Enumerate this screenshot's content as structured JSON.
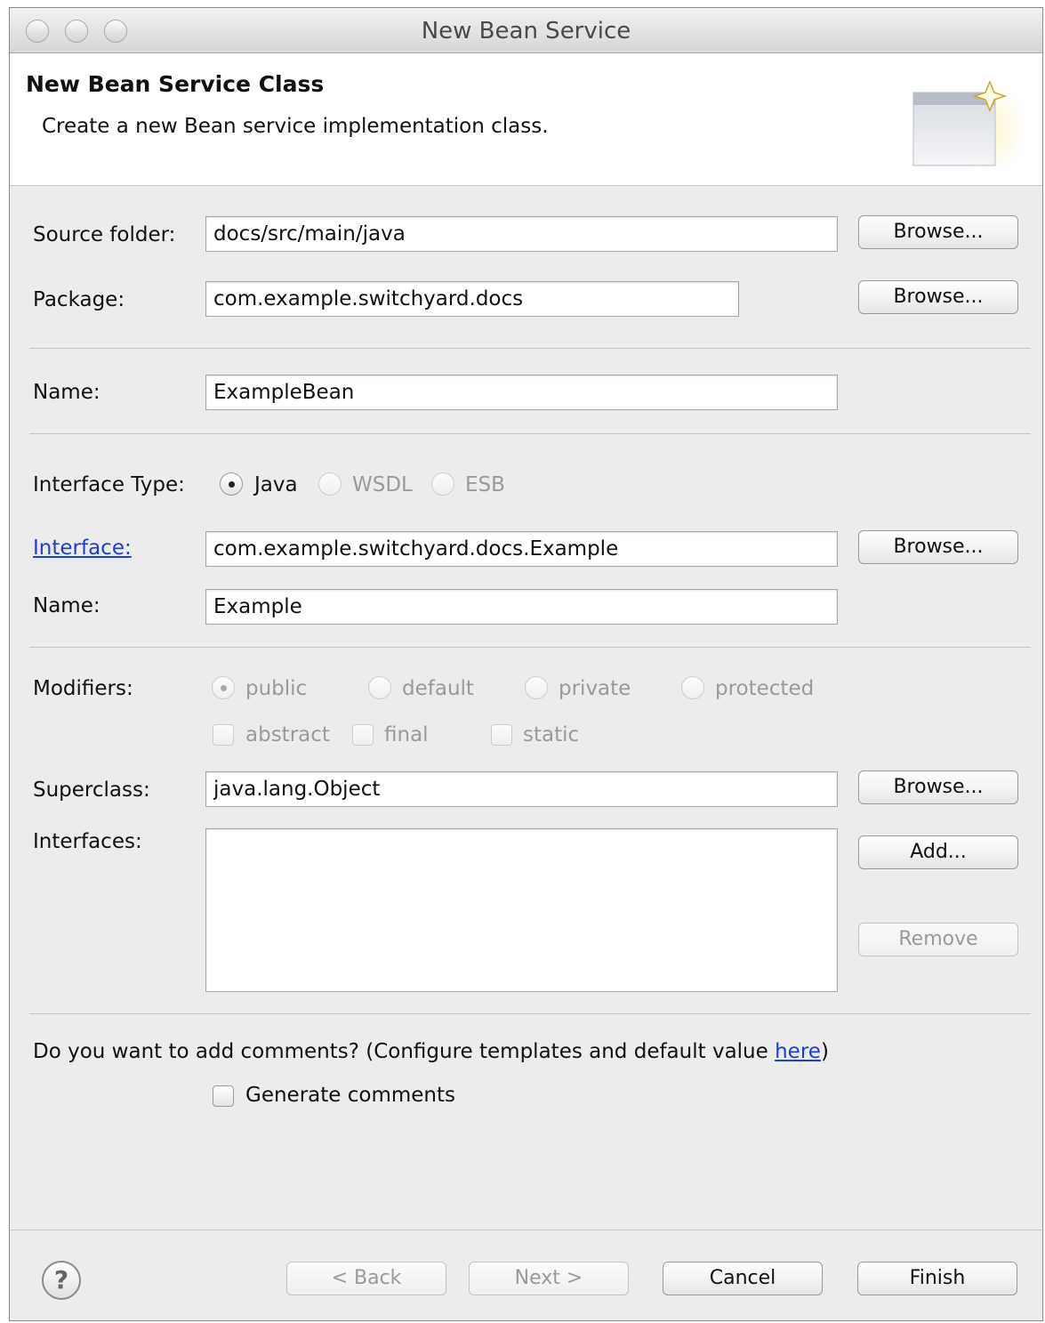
{
  "window": {
    "title": "New Bean Service"
  },
  "banner": {
    "title": "New Bean Service Class",
    "description": "Create a new Bean service implementation class."
  },
  "source_folder": {
    "label": "Source folder:",
    "value": "docs/src/main/java",
    "browse": "Browse..."
  },
  "package": {
    "label": "Package:",
    "value": "com.example.switchyard.docs",
    "browse": "Browse..."
  },
  "name": {
    "label": "Name:",
    "value": "ExampleBean"
  },
  "interface_type": {
    "label": "Interface Type:",
    "options": [
      "Java",
      "WSDL",
      "ESB"
    ],
    "selected": "Java"
  },
  "interface": {
    "label": "Interface:",
    "value": "com.example.switchyard.docs.Example",
    "browse": "Browse..."
  },
  "interface_name": {
    "label": "Name:",
    "value": "Example"
  },
  "modifiers": {
    "label": "Modifiers:",
    "access": [
      "public",
      "default",
      "private",
      "protected"
    ],
    "selected": "public",
    "flags": [
      "abstract",
      "final",
      "static"
    ]
  },
  "superclass": {
    "label": "Superclass:",
    "value": "java.lang.Object",
    "browse": "Browse..."
  },
  "interfaces": {
    "label": "Interfaces:",
    "add": "Add...",
    "remove": "Remove"
  },
  "comments": {
    "prompt": "Do you want to add comments? (Configure templates and default value ",
    "link": "here",
    "suffix": ")",
    "checkbox": "Generate comments",
    "checked": false
  },
  "footer": {
    "help": "?",
    "back": "< Back",
    "next": "Next >",
    "cancel": "Cancel",
    "finish": "Finish"
  }
}
